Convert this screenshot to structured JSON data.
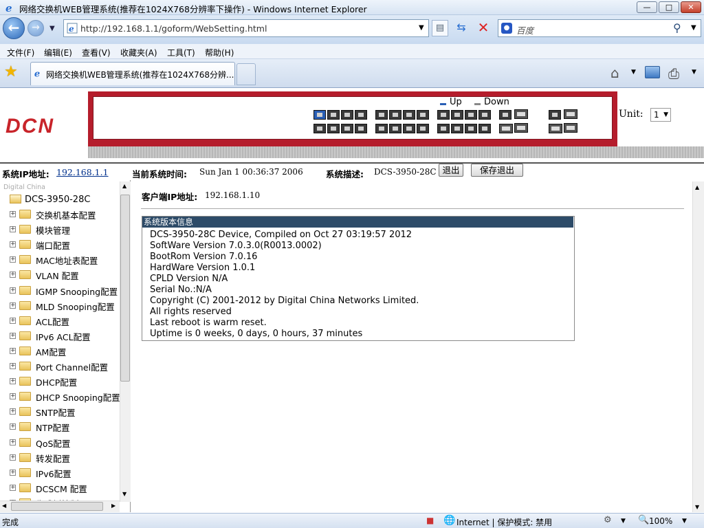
{
  "window": {
    "title": "网络交换机WEB管理系统(推荐在1024X768分辨率下操作) - Windows Internet Explorer",
    "min_label": "—",
    "max_label": "□",
    "close_label": "✕"
  },
  "address": {
    "url": "http://192.168.1.1/goform/WebSetting.html"
  },
  "search": {
    "placeholder": "百度"
  },
  "menu": [
    "文件(F)",
    "编辑(E)",
    "查看(V)",
    "收藏夹(A)",
    "工具(T)",
    "帮助(H)"
  ],
  "tab": {
    "title": "网络交换机WEB管理系统(推荐在1024X768分辨..."
  },
  "header": {
    "logo": "DCN",
    "legend_up": "Up",
    "legend_down": "Down",
    "unit_label": "Unit:",
    "unit_value": "1",
    "ports_up": [
      0
    ]
  },
  "infobar": {
    "ip_label": "系统IP地址:",
    "ip_value": "192.168.1.1",
    "time_label": "当前系统时间:",
    "time_value": "Sun Jan 1 00:36:37 2006",
    "desc_label": "系统描述:",
    "desc_value": "DCS-3950-28C",
    "logout": "退出",
    "save_logout": "保存退出"
  },
  "sidebar": {
    "watermark": "Digital China",
    "root": "DCS-3950-28C",
    "items": [
      "交换机基本配置",
      "模块管理",
      "端口配置",
      "MAC地址表配置",
      "VLAN 配置",
      "IGMP Snooping配置",
      "MLD Snooping配置",
      "ACL配置",
      "IPv6 ACL配置",
      "AM配置",
      "Port Channel配置",
      "DHCP配置",
      "DHCP Snooping配置",
      "SNTP配置",
      "NTP配置",
      "QoS配置",
      "转发配置",
      "IPv6配置",
      "DCSCM 配置",
      "生成树控制"
    ]
  },
  "main": {
    "client_ip_label": "客户端IP地址:",
    "client_ip_value": "192.168.1.10",
    "version_header": "系统版本信息",
    "version_lines": [
      "DCS-3950-28C Device, Compiled on Oct 27 03:19:57 2012",
      "SoftWare Version 7.0.3.0(R0013.0002)",
      "BootRom Version 7.0.16",
      "HardWare Version 1.0.1",
      "CPLD Version N/A",
      "Serial No.:N/A",
      "Copyright (C) 2001-2012 by Digital China Networks Limited.",
      "All rights reserved",
      "Last reboot is warm reset.",
      "Uptime is 0 weeks, 0 days, 0 hours, 37 minutes"
    ]
  },
  "status": {
    "left": "完成",
    "zone": "Internet | 保护模式: 禁用",
    "zoom": "100%"
  }
}
